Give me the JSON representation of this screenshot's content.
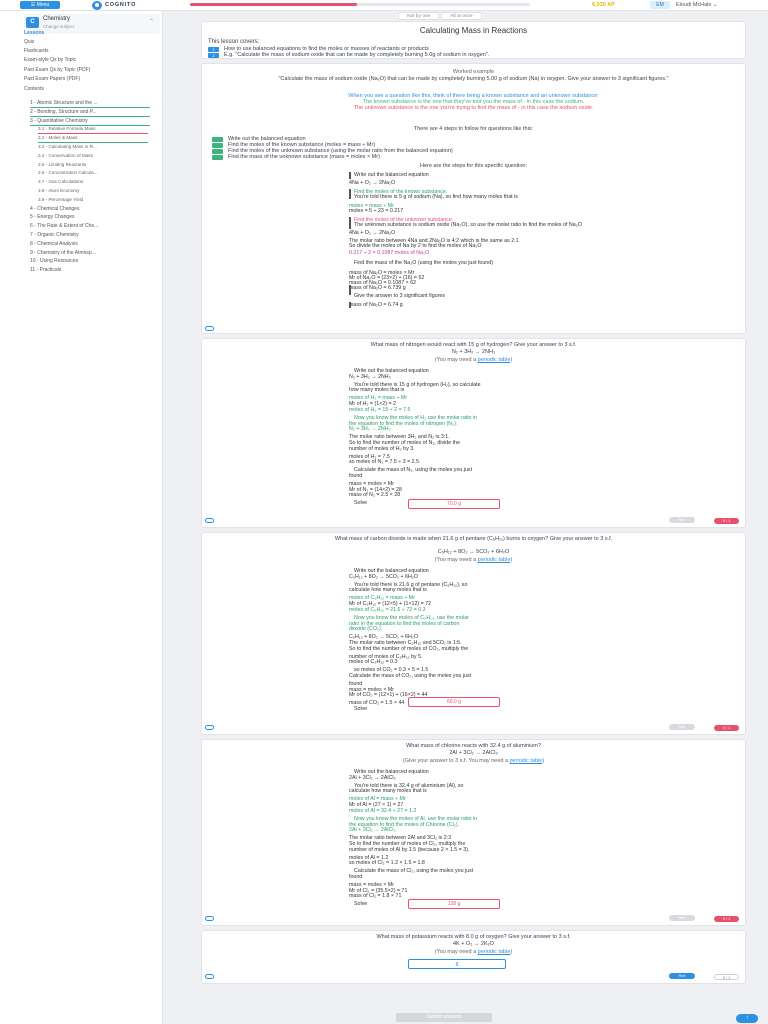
{
  "topbar": {
    "menu_label": "Menu",
    "logo": "COGNITO",
    "progress_fraction": 0.49,
    "xp": "6,035 XP",
    "avatar": "EM",
    "username": "Eloudi McHale"
  },
  "sidebar": {
    "course_letter": "C",
    "course_title": "Chemistry",
    "course_sub": "Change subject",
    "items": [
      {
        "label": "Lessons",
        "active": true
      },
      {
        "label": "Quiz"
      },
      {
        "label": "Flashcards"
      },
      {
        "label": "Exam-style Qs by Topic"
      },
      {
        "label": "Past Exam Qs by Topic (PDF)"
      },
      {
        "label": "Past Exam Papers (PDF)"
      },
      {
        "label": "Contents"
      }
    ],
    "chapters": [
      "1 - Atomic Structure and the ...",
      "2 - Bonding, Structure and P...",
      "3 - Quantitative Chemistry",
      "3.1 - Relative Formula Mass",
      "3.2 - Moles & Mass",
      "3.3 - Calculating Mass in R...",
      "3.4 - Conservation of Mass",
      "3.5 - Limiting Reactants",
      "3.6 - Concentration Calcula...",
      "3.7 - Gas Calculations",
      "3.8 - Atom Economy",
      "3.9 - Percentage Yield",
      "4 - Chemical Changes",
      "5 - Energy Changes",
      "6 - The Rate & Extent of Che...",
      "7 - Organic Chemistry",
      "8 - Chemical Analysis",
      "9 - Chemistry of the Atmosp...",
      "10 - Using Resources",
      "11 - Practicals"
    ]
  },
  "tabs": [
    "Not by one",
    "All at once"
  ],
  "lesson": {
    "title": "Calculating Mass in Reactions",
    "covers_label": "This lesson covers:",
    "covers": [
      "How to use balanced equations to find the moles or masses of reactants or products",
      "E.g. \"Calculate the mass of sodium oxide that can be made by completely burning 5.0g of sodium in oxygen\"."
    ]
  },
  "example": {
    "heading": "Worked example",
    "question": "\"Calculate the mass of sodium oxide (Na₂O) that can be made by completely burning 5.00 g of sodium (Na) in oxygen. Give your answer to 3 significant figures.\"",
    "intro": "When you see a question like this, think of there being a known substance and an unknown substance:",
    "known": "The known substance is the one that they've told you the mass of - in this case the sodium.",
    "unknown": "The unknown substance is the one you're trying to find the mass of - in this case the sodium oxide.",
    "steps_intro": "There are 4 steps to follow for questions like this:",
    "steps": [
      "Write out the balanced equation",
      "Find the moles of the known substance (moles = mass ÷ Mr)",
      "Find the moles of the unknown substance (using the molar ratio from the balanced equation)",
      "Find the mass of the unknown substance (mass = moles × Mr)"
    ],
    "here": "Here are the steps for this specific question:",
    "lines": [
      "Write out the balanced equation",
      "4Na + O₂ → 2Na₂O",
      "Find the moles of the known substance.",
      "You're told there is 5 g of sodium (Na), so find how many moles that is",
      "moles = mass ÷ Mr",
      "moles = 5 ÷ 23 = 0.217",
      "Find the moles of the unknown substance.",
      "The unknown substance is sodium oxide (Na₂O), so use the molar ratio to find the moles of Na₂O",
      "4Na + O₂ → 2Na₂O",
      "The molar ratio between 4Na and 2Na₂O is 4:2 which is the same as 2:1",
      "So divide the moles of Na by 2 to find the moles of Na₂O",
      "0.217 ÷ 2 = 0.1087 moles of Na₂O",
      "Find the mass of the Na₂O (using the moles you just found)",
      "mass of Na₂O = moles × Mr",
      "Mr of Na₂O = (23×2) + (16) = 62",
      "mass of Na₂O = 0.1087 × 62",
      "mass of Na₂O = 6.739 g",
      "Give the answer to 3 significant figures",
      "mass of Na₂O = 6.74 g"
    ]
  },
  "q1": {
    "question": "What mass of nitrogen would react with 15 g of hydrogen? Give your answer to 3 s.f.",
    "equation": "N₂ + 3H₂ → 2NH₃",
    "hint_pre": "(You may need a ",
    "hint_link": "periodic table",
    "hint_post": ")",
    "lines": [
      "Write out the balanced equation",
      "N₂ + 3H₂ → 2NH₃",
      "You're told there is 15 g of hydrogen (H₂), so calculate",
      "how many moles that is",
      "moles of H₂ = mass ÷ Mr",
      "Mr of H₂ = (1×2) = 2",
      "moles of H₂ = 15 ÷ 2 = 7.5",
      "Now you know the moles of H₂ use the molar ratio in",
      "the equation to find the moles of nitrogen (N₂):",
      "N₂ + 3H₂ → 2NH₃",
      "The molar ratio between 3H₂ and N₂ is 3:1.",
      "So to find the number of moles of N₂, divide the",
      "number of moles of H₂ by 3.",
      "moles of H₂ = 7.5",
      "so moles of N₂ = 7.5 ÷ 3 = 2.5",
      "Calculate the mass of N₂, using the moles you just",
      "found",
      "mass = moles × Mr",
      "Mr of N₂ = (14×2) = 28",
      "mass of N₂ = 2.5 × 28",
      "Solve"
    ],
    "answer": "70.0  g",
    "hint": "Hint",
    "score": "0 / 1"
  },
  "q2": {
    "question": "What mass of carbon dioxide is made when 21.6 g of pentane (C₅H₁₂) burns in oxygen? Give your answer to 3 s.f.",
    "equation": "C₅H₁₂ + 8O₂ → 5CO₂ + 6H₂O",
    "hint_pre": "(You may need a ",
    "hint_link": "periodic table",
    "hint_post": ")",
    "lines": [
      "Write out the balanced equation",
      "C₅H₁₂ + 8O₂ → 5CO₂ + 6H₂O",
      "You're told there is 21.6 g of pentane (C₅H₁₂), so",
      "calculate how many moles that is",
      "moles of C₅H₁₂ = mass ÷ Mr",
      "Mr of C₅H₁₂ = (12×5) + (1×12) = 72",
      "moles of C₅H₁₂ = 21.6 ÷ 72 = 0.3",
      "Now you know the moles of C₅H₁₂, use the molar",
      "ratio in the equation to find the moles of carbon",
      "dioxide (CO₂).",
      "C₅H₁₂ + 8O₂ → 5CO₂ + 6H₂O",
      "The molar ratio between C₅H₁₂ and 5CO₂ is 1:5.",
      "So to find the number of moles of CO₂, multiply the",
      "number of moles of C₅H₁₂ by 5.",
      "moles of C₅H₁₂ = 0.3",
      "so moles of CO₂ = 0.3 × 5 = 1.5",
      "Calculate the mass of CO₂, using the moles you just",
      "found",
      "mass = moles × Mr",
      "Mr of CO₂ = (12×1) + (16×2) = 44",
      "mass of CO₂ = 1.5 × 44",
      "Solve"
    ],
    "answer": "66.0  g",
    "hint": "Hint",
    "score": "0 / 1"
  },
  "q3": {
    "question": "What mass of chlorine reacts with 32.4 g of aluminium?",
    "equation": "2Al + 3Cl₂ → 2AlCl₃",
    "hint_pre": "(Give your answer to 3 s.f. You may need a ",
    "hint_link": "periodic table",
    "hint_post": ")",
    "lines": [
      "Write out the balanced equation",
      "2Al + 3Cl₂ → 2AlCl₃",
      "You're told there is 32.4 g of aluminium (Al), so",
      "calculate how many moles that is",
      "moles of Al = mass ÷ Mr",
      "Mr of Al = (27 × 1) = 27",
      "moles of Al = 32.4 ÷ 27 = 1.2",
      "Now you know the moles of Al, use the molar ratio in",
      "the equation to find the moles of Chlorine (Cl₂).",
      "2Al + 3Cl₂ → 2AlCl₃",
      "The molar ratio between 2Al and 3Cl₂ is 2:3",
      "So to find the number of moles of Cl₂, multiply the",
      "number of moles of Al by 1.5 (because 2 × 1.5 = 3).",
      "moles of Al = 1.2",
      "so moles of Cl₂ = 1.2 × 1.5 = 1.8",
      "Calculate the mass of Cl₂, using the moles you just",
      "found",
      "mass = moles × Mr",
      "Mr of Cl₂ = (35.5×2) = 71",
      "mass of Cl₂ = 1.8 × 71",
      "Solve"
    ],
    "answer": "128  g",
    "hint": "Hint",
    "score": "0 / 1"
  },
  "q4": {
    "question": "What mass of potassium reacts with 8.0 g of oxygen? Give your answer to 3 s.f.",
    "equation": "4K + O₂ → 2K₂O",
    "hint_pre": "(You may need a ",
    "hint_link": "periodic table",
    "hint_post": ")",
    "answer": "g",
    "hint": "Hint",
    "score": "0 / 1"
  },
  "footer": {
    "submit": "Submit answers",
    "fab": "↑"
  }
}
